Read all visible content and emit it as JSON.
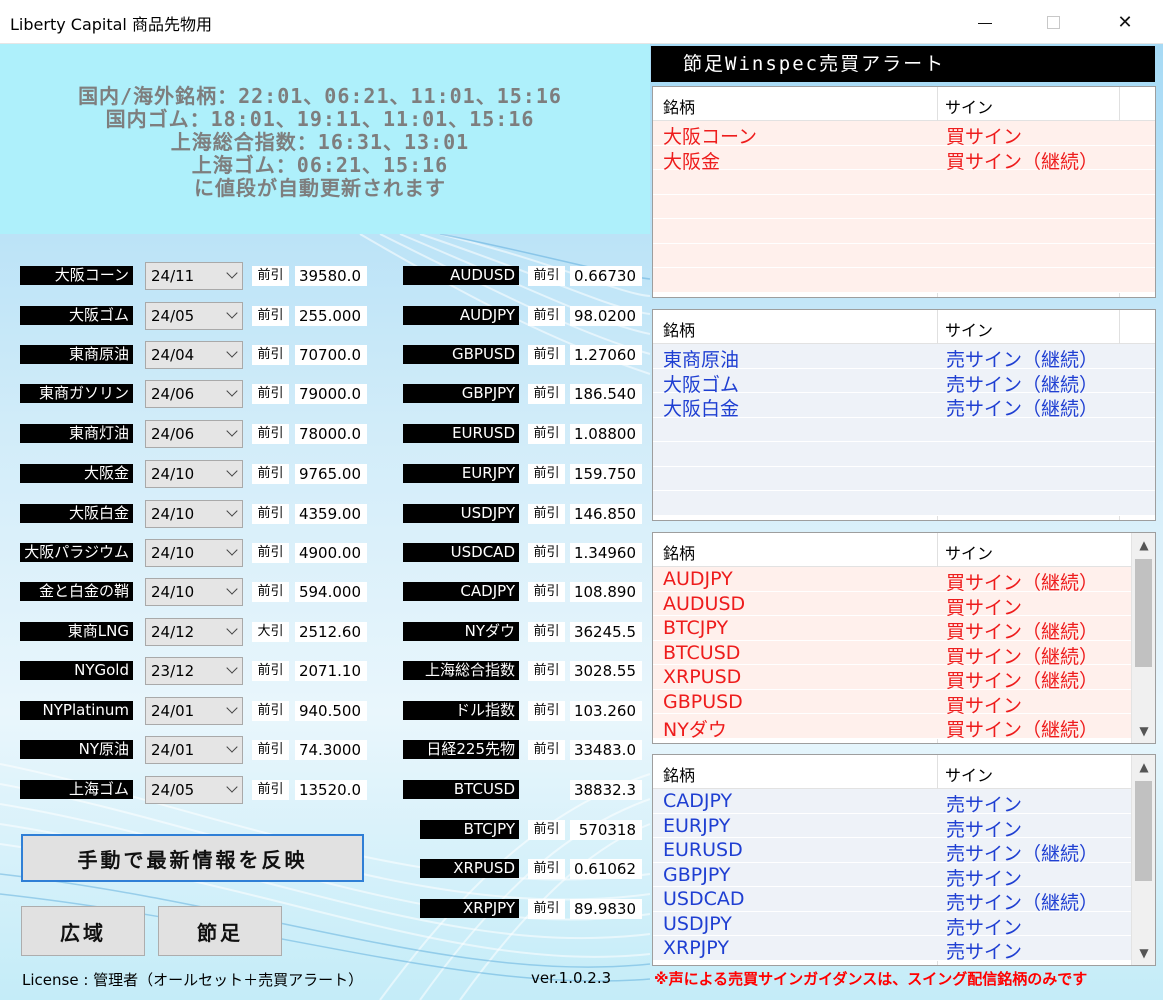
{
  "window": {
    "title": "Liberty Capital 商品先物用",
    "minimize_glyph": "—",
    "close_glyph": "✕"
  },
  "info": {
    "lines": [
      "国内/海外銘柄：22:01、06:21、11:01、15:16",
      "国内ゴム：18:01、19:11、11:01、15:16",
      "上海総合指数：16:31、13:01",
      "上海ゴム：06:21、15:16",
      "に値段が自動更新されます"
    ]
  },
  "domestic": [
    {
      "name": "大阪コーン",
      "month": "24/11",
      "type": "前引",
      "value": "39580.0"
    },
    {
      "name": "大阪ゴム",
      "month": "24/05",
      "type": "前引",
      "value": "255.000"
    },
    {
      "name": "東商原油",
      "month": "24/04",
      "type": "前引",
      "value": "70700.0"
    },
    {
      "name": "東商ガソリン",
      "month": "24/06",
      "type": "前引",
      "value": "79000.0"
    },
    {
      "name": "東商灯油",
      "month": "24/06",
      "type": "前引",
      "value": "78000.0"
    },
    {
      "name": "大阪金",
      "month": "24/10",
      "type": "前引",
      "value": "9765.00"
    },
    {
      "name": "大阪白金",
      "month": "24/10",
      "type": "前引",
      "value": "4359.00"
    },
    {
      "name": "大阪パラジウム",
      "month": "24/10",
      "type": "前引",
      "value": "4900.00"
    },
    {
      "name": "金と白金の鞘",
      "month": "24/10",
      "type": "前引",
      "value": "594.000"
    },
    {
      "name": "東商LNG",
      "month": "24/12",
      "type": "大引",
      "value": "2512.60"
    },
    {
      "name": "NYGold",
      "month": "23/12",
      "type": "前引",
      "value": "2071.10"
    },
    {
      "name": "NYPlatinum",
      "month": "24/01",
      "type": "前引",
      "value": "940.500"
    },
    {
      "name": "NY原油",
      "month": "24/01",
      "type": "前引",
      "value": "74.3000"
    },
    {
      "name": "上海ゴム",
      "month": "24/05",
      "type": "前引",
      "value": "13520.0"
    }
  ],
  "fx": [
    {
      "name": "AUDUSD",
      "type": "前引",
      "value": "0.66730"
    },
    {
      "name": "AUDJPY",
      "type": "前引",
      "value": "98.0200"
    },
    {
      "name": "GBPUSD",
      "type": "前引",
      "value": "1.27060"
    },
    {
      "name": "GBPJPY",
      "type": "前引",
      "value": "186.540"
    },
    {
      "name": "EURUSD",
      "type": "前引",
      "value": "1.08800"
    },
    {
      "name": "EURJPY",
      "type": "前引",
      "value": "159.750"
    },
    {
      "name": "USDJPY",
      "type": "前引",
      "value": "146.850"
    },
    {
      "name": "USDCAD",
      "type": "前引",
      "value": "1.34960"
    },
    {
      "name": "CADJPY",
      "type": "前引",
      "value": "108.890"
    },
    {
      "name": "NYダウ",
      "type": "前引",
      "value": "36245.5"
    },
    {
      "name": "上海総合指数",
      "type": "前引",
      "value": "3028.55"
    },
    {
      "name": "ドル指数",
      "type": "前引",
      "value": "103.260"
    },
    {
      "name": "日経225先物",
      "type": "前引",
      "value": "33483.0"
    },
    {
      "name": "BTCUSD",
      "type": "",
      "value": "38832.3"
    },
    {
      "name": "BTCJPY",
      "type": "前引",
      "value": "570318"
    },
    {
      "name": "XRPUSD",
      "type": "前引",
      "value": "0.61062"
    },
    {
      "name": "XRPJPY",
      "type": "前引",
      "value": "89.9830"
    }
  ],
  "buttons": {
    "refresh": "手動で最新情報を反映",
    "wide": "広域",
    "bar": "節足"
  },
  "footer": {
    "license": "License : 管理者（オールセット＋売買アラート）",
    "version": "ver.1.0.2.3",
    "notice": "※声による売買サインガイダンスは、スイング配信銘柄のみです"
  },
  "alerts": {
    "header": "節足Winspec売買アラート",
    "col_name": "銘柄",
    "col_sign": "サイン",
    "panels": [
      {
        "kind": "buy",
        "rows": [
          {
            "name": "大阪コーン",
            "sign": "買サイン"
          },
          {
            "name": "大阪金",
            "sign": "買サイン（継続）"
          }
        ]
      },
      {
        "kind": "sell",
        "rows": [
          {
            "name": "東商原油",
            "sign": "売サイン（継続）"
          },
          {
            "name": "大阪ゴム",
            "sign": "売サイン（継続）"
          },
          {
            "name": "大阪白金",
            "sign": "売サイン（継続）"
          }
        ]
      },
      {
        "kind": "buy",
        "rows": [
          {
            "name": "AUDJPY",
            "sign": "買サイン（継続）"
          },
          {
            "name": "AUDUSD",
            "sign": "買サイン"
          },
          {
            "name": "BTCJPY",
            "sign": "買サイン（継続）"
          },
          {
            "name": "BTCUSD",
            "sign": "買サイン（継続）"
          },
          {
            "name": "XRPUSD",
            "sign": "買サイン（継続）"
          },
          {
            "name": "GBPUSD",
            "sign": "買サイン"
          },
          {
            "name": "NYダウ",
            "sign": "買サイン（継続）"
          }
        ]
      },
      {
        "kind": "sell",
        "rows": [
          {
            "name": "CADJPY",
            "sign": "売サイン"
          },
          {
            "name": "EURJPY",
            "sign": "売サイン"
          },
          {
            "name": "EURUSD",
            "sign": "売サイン（継続）"
          },
          {
            "name": "GBPJPY",
            "sign": "売サイン"
          },
          {
            "name": "USDCAD",
            "sign": "売サイン（継続）"
          },
          {
            "name": "USDJPY",
            "sign": "売サイン"
          },
          {
            "name": "XRPJPY",
            "sign": "売サイン"
          }
        ]
      }
    ]
  },
  "colors": {
    "buy_text": "#ee1c1c",
    "sell_text": "#1f3fd2",
    "info_text": "#7e7e7e",
    "notice_text": "#ff0000"
  }
}
